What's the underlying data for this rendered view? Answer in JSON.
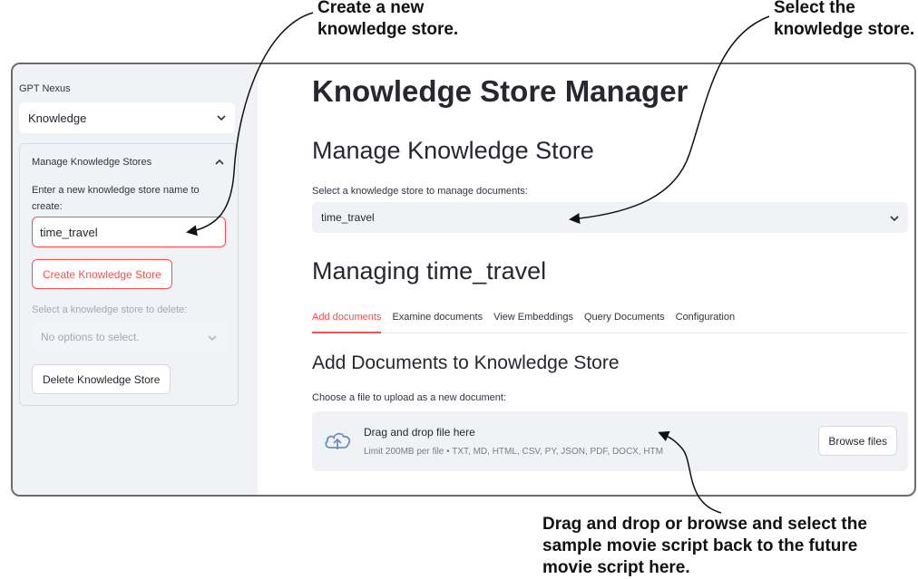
{
  "annotations": {
    "create": "Create a new\nknowledge store.",
    "select": "Select the\nknowledge store.",
    "drag": "Drag and drop or browse and select the\nsample movie script back to the future\nmovie script here."
  },
  "sidebar": {
    "app_label": "GPT Nexus",
    "page_select": "Knowledge",
    "expander": {
      "title": "Manage Knowledge Stores",
      "create_prompt": "Enter a new knowledge store name to create:",
      "create_input_value": "time_travel",
      "create_button": "Create Knowledge Store",
      "delete_label": "Select a knowledge store to delete:",
      "delete_placeholder": "No options to select.",
      "delete_button": "Delete Knowledge Store"
    }
  },
  "main": {
    "title": "Knowledge Store Manager",
    "manage_heading": "Manage Knowledge Store",
    "select_label": "Select a knowledge store to manage documents:",
    "select_value": "time_travel",
    "managing_heading": "Managing time_travel",
    "tabs": [
      {
        "label": "Add documents",
        "active": true
      },
      {
        "label": "Examine documents",
        "active": false
      },
      {
        "label": "View Embeddings",
        "active": false
      },
      {
        "label": "Query Documents",
        "active": false
      },
      {
        "label": "Configuration",
        "active": false
      }
    ],
    "add_heading": "Add Documents to Knowledge Store",
    "upload_label": "Choose a file to upload as a new document:",
    "dropzone": {
      "title": "Drag and drop file here",
      "limits": "Limit 200MB per file • TXT, MD, HTML, CSV, PY, JSON, PDF, DOCX, HTM",
      "browse_button": "Browse files"
    }
  },
  "colors": {
    "accent": "#ff4b4b",
    "sidebar_bg": "#f0f2f6",
    "text": "#262730"
  },
  "icons": {
    "select_chevron": "chevron-down-icon",
    "expander_chevron": "chevron-up-icon",
    "upload": "cloud-upload-icon"
  }
}
